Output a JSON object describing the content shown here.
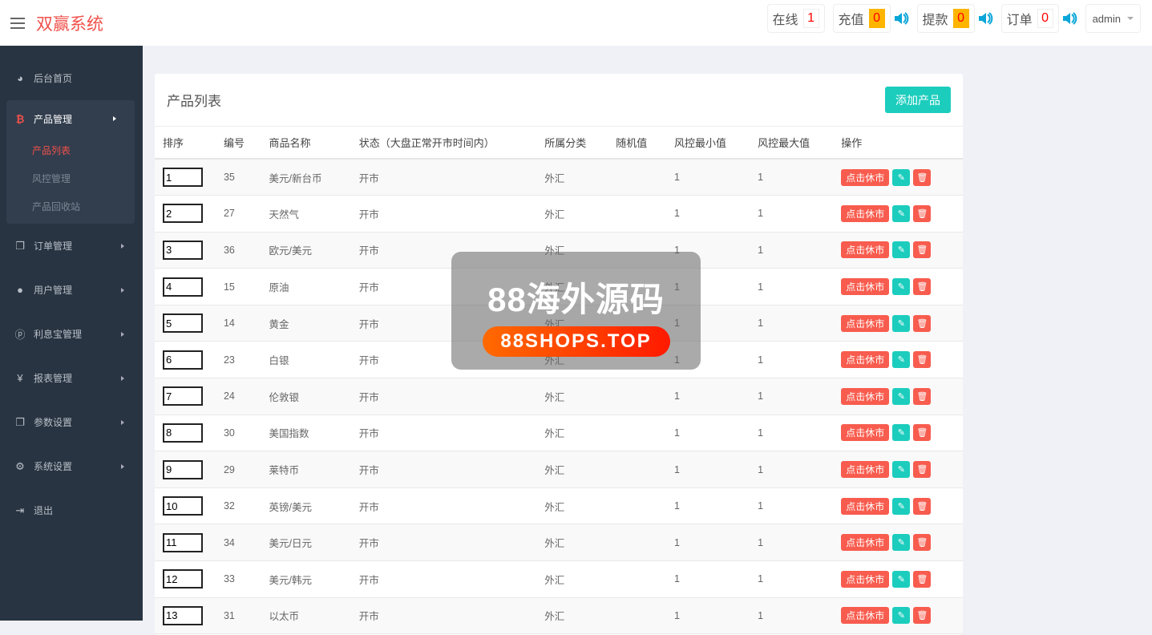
{
  "header": {
    "brand": "双赢系统",
    "stats": [
      {
        "label": "在线",
        "value": "1",
        "highlight": false,
        "sound": false
      },
      {
        "label": "充值",
        "value": "0",
        "highlight": true,
        "sound": true
      },
      {
        "label": "提款",
        "value": "0",
        "highlight": true,
        "sound": true
      },
      {
        "label": "订单",
        "value": "0",
        "highlight": false,
        "sound": true
      }
    ],
    "user": "admin"
  },
  "sidebar": {
    "home": "后台首页",
    "product": "产品管理",
    "product_sub": [
      "产品列表",
      "风控管理",
      "产品回收站"
    ],
    "items": [
      {
        "label": "订单管理",
        "icon": "copy"
      },
      {
        "label": "用户管理",
        "icon": "user"
      },
      {
        "label": "利息宝管理",
        "icon": "pinterest"
      },
      {
        "label": "报表管理",
        "icon": "yen"
      },
      {
        "label": "参数设置",
        "icon": "copy"
      },
      {
        "label": "系统设置",
        "icon": "gears"
      }
    ],
    "logout": "退出"
  },
  "main": {
    "title": "产品列表",
    "add_button": "添加产品",
    "columns": [
      "排序",
      "编号",
      "商品名称",
      "状态（大盘正常开市时间内）",
      "所属分类",
      "随机值",
      "风控最小值",
      "风控最大值",
      "操作"
    ],
    "action_close": "点击休市",
    "rows": [
      [
        "1",
        "35",
        "美元/新台币",
        "开市",
        "外汇",
        "",
        "1",
        "1"
      ],
      [
        "2",
        "27",
        "天然气",
        "开市",
        "外汇",
        "",
        "1",
        "1"
      ],
      [
        "3",
        "36",
        "欧元/美元",
        "开市",
        "外汇",
        "",
        "1",
        "1"
      ],
      [
        "4",
        "15",
        "原油",
        "开市",
        "外汇",
        "",
        "1",
        "1"
      ],
      [
        "5",
        "14",
        "黄金",
        "开市",
        "外汇",
        "",
        "1",
        "1"
      ],
      [
        "6",
        "23",
        "白银",
        "开市",
        "外汇",
        "",
        "1",
        "1"
      ],
      [
        "7",
        "24",
        "伦敦银",
        "开市",
        "外汇",
        "",
        "1",
        "1"
      ],
      [
        "8",
        "30",
        "美国指数",
        "开市",
        "外汇",
        "",
        "1",
        "1"
      ],
      [
        "9",
        "29",
        "莱特币",
        "开市",
        "外汇",
        "",
        "1",
        "1"
      ],
      [
        "10",
        "32",
        "英镑/美元",
        "开市",
        "外汇",
        "",
        "1",
        "1"
      ],
      [
        "11",
        "34",
        "美元/日元",
        "开市",
        "外汇",
        "",
        "1",
        "1"
      ],
      [
        "12",
        "33",
        "美元/韩元",
        "开市",
        "外汇",
        "",
        "1",
        "1"
      ],
      [
        "13",
        "31",
        "以太币",
        "开市",
        "外汇",
        "",
        "1",
        "1"
      ]
    ]
  },
  "watermark": {
    "line1": "88海外源码",
    "line2": "88SHOPS.TOP"
  }
}
